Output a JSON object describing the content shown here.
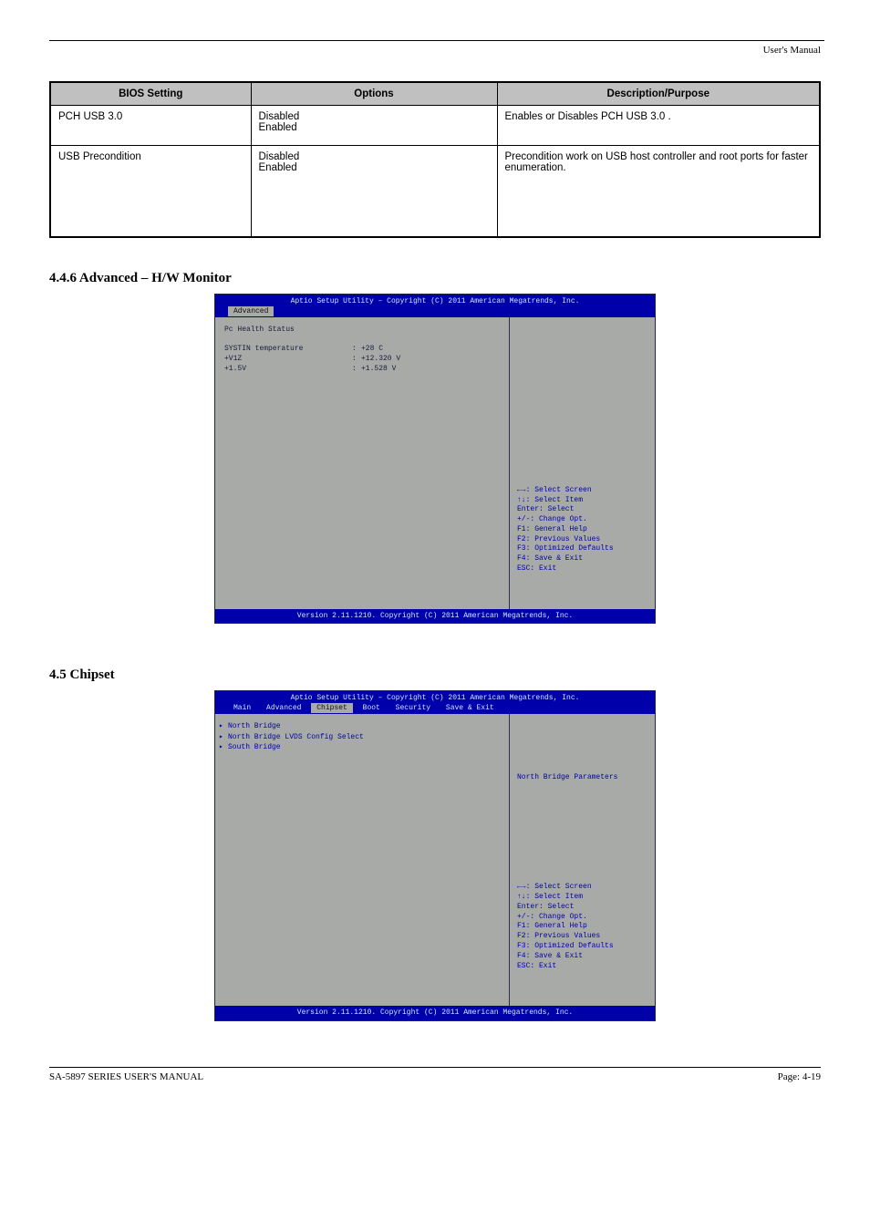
{
  "header": {
    "right": "User's Manual"
  },
  "table": {
    "headers": [
      "BIOS Setting",
      "Options",
      "Description/Purpose"
    ],
    "rows": [
      {
        "setting": "PCH USB 3.0",
        "options": "Disabled\nEnabled",
        "desc": "Enables or Disables PCH USB 3.0 ."
      },
      {
        "setting": "USB Precondition",
        "options": "Disabled\nEnabled",
        "desc": "Precondition work on USB host controller and root ports for faster enumeration."
      }
    ]
  },
  "sections": {
    "s1": "4.4.6 Advanced – H/W Monitor",
    "s2": "4.5 Chipset"
  },
  "bios1": {
    "title": "Aptio Setup Utility – Copyright (C) 2011 American Megatrends, Inc.",
    "tab_active": "Advanced",
    "heading": "Pc Health Status",
    "rows": [
      {
        "k": "SYSTIN temperature",
        "v": "+28 C"
      },
      {
        "k": "+V1Z",
        "v": "+12.320 V"
      },
      {
        "k": "+1.5V",
        "v": "+1.528 V"
      }
    ],
    "help_lines": [
      "←→: Select Screen",
      "↑↓: Select Item",
      "Enter: Select",
      "+/-: Change Opt.",
      "F1: General Help",
      "F2: Previous Values",
      "F3: Optimized Defaults",
      "F4: Save & Exit",
      "ESC: Exit"
    ],
    "bottom": "Version 2.11.1210. Copyright (C) 2011 American Megatrends, Inc."
  },
  "bios2": {
    "title": "Aptio Setup Utility – Copyright (C) 2011 American Megatrends, Inc.",
    "tabs": [
      "Main",
      "Advanced",
      "Chipset",
      "Boot",
      "Security",
      "Save & Exit"
    ],
    "tab_active": "Chipset",
    "menu": [
      "North Bridge",
      "North Bridge LVDS Config Select",
      "South Bridge"
    ],
    "right_desc": "North Bridge Parameters",
    "help_lines": [
      "←→: Select Screen",
      "↑↓: Select Item",
      "Enter: Select",
      "+/-: Change Opt.",
      "F1: General Help",
      "F2: Previous Values",
      "F3: Optimized Defaults",
      "F4: Save & Exit",
      "ESC: Exit"
    ],
    "bottom": "Version 2.11.1210. Copyright (C) 2011 American Megatrends, Inc."
  },
  "footer": {
    "left": "SA-5897 SERIES USER'S MANUAL",
    "right": "Page: 4-19"
  }
}
